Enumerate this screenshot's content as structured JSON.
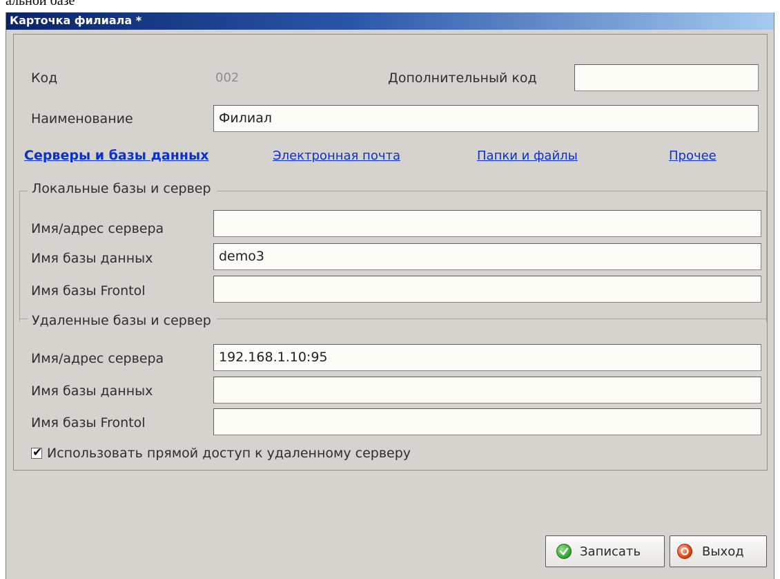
{
  "background_fragment": "альной базе",
  "window": {
    "title": "Карточка филиала *"
  },
  "header": {
    "code_label": "Код",
    "code_value": "002",
    "extra_code_label": "Дополнительный код",
    "extra_code_value": "",
    "name_label": "Наименование",
    "name_value": "Филиал"
  },
  "tabs": [
    {
      "label": "Серверы и базы данных",
      "active": true
    },
    {
      "label": "Электронная почта",
      "active": false
    },
    {
      "label": "Папки и файлы",
      "active": false
    },
    {
      "label": "Прочее",
      "active": false
    }
  ],
  "local_group": {
    "legend": "Локальные базы и сервер",
    "server_label": "Имя/адрес сервера",
    "server_value": "",
    "db_label": "Имя базы данных",
    "db_value": "demo3",
    "frontol_label": "Имя базы Frontol",
    "frontol_value": ""
  },
  "remote_group": {
    "legend": "Удаленные  базы и сервер",
    "server_label": "Имя/адрес сервера",
    "server_value": "192.168.1.10:95",
    "db_label": "Имя базы данных",
    "db_value": "",
    "frontol_label": "Имя базы Frontol",
    "frontol_value": ""
  },
  "direct_access": {
    "label": "Использовать прямой доступ к удаленному серверу",
    "checked": true
  },
  "buttons": {
    "save_label": "Записать",
    "exit_label": "Выход"
  },
  "colors": {
    "title_gradient_start": "#0a246a",
    "title_gradient_end": "#a6caf0",
    "link": "#0b32c8",
    "window_bg": "#d6d3ce",
    "save_icon": "#3aa935",
    "exit_icon": "#e2461a"
  }
}
